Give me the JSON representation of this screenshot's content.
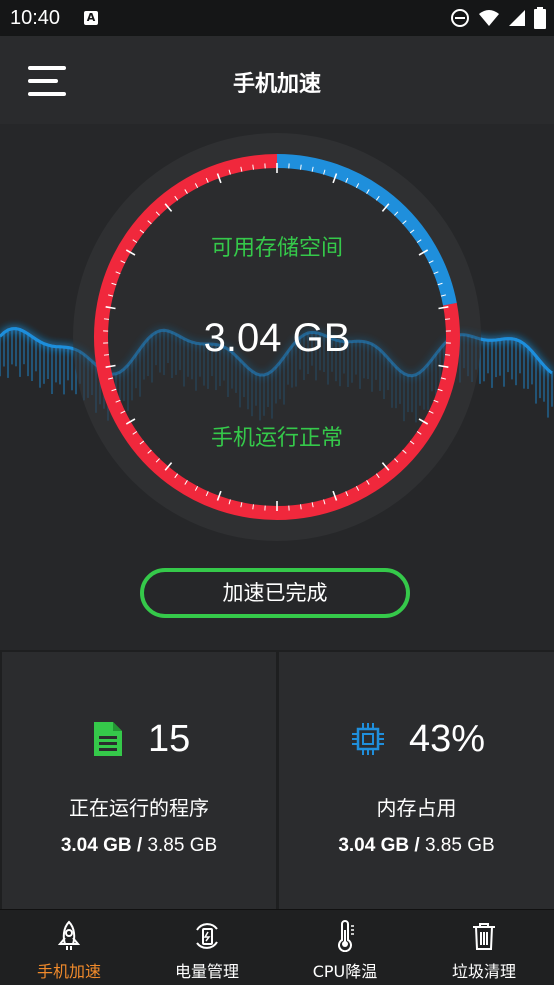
{
  "status_bar": {
    "time": "10:40",
    "notification_glyph": "A",
    "icons": [
      "dnd-icon",
      "wifi-icon",
      "signal-icon",
      "battery-icon"
    ]
  },
  "header": {
    "title": "手机加速",
    "menu_icon": "hamburger-menu-icon"
  },
  "gauge": {
    "top_label": "可用存储空间",
    "value": "3.04 GB",
    "bottom_label": "手机运行正常",
    "free_fraction": 0.22,
    "colors": {
      "used": "#f0283c",
      "free": "#1f8fdc",
      "wave": "#1f8fdc",
      "ring_bg": "#2f3032"
    }
  },
  "action_button": {
    "label": "加速已完成",
    "color": "#35c94a"
  },
  "stats": {
    "programs": {
      "icon": "document-icon",
      "count": "15",
      "label": "正在运行的程序",
      "used": "3.04 GB",
      "separator": " / ",
      "total": "3.85 GB"
    },
    "memory": {
      "icon": "cpu-chip-icon",
      "percent": "43%",
      "label": "内存占用",
      "used": "3.04 GB",
      "separator": " / ",
      "total": "3.85 GB"
    }
  },
  "tabs": [
    {
      "label": "手机加速",
      "icon": "rocket-icon",
      "active": true
    },
    {
      "label": "电量管理",
      "icon": "battery-refresh-icon",
      "active": false
    },
    {
      "label": "CPU降温",
      "icon": "thermometer-icon",
      "active": false
    },
    {
      "label": "垃圾清理",
      "icon": "trash-icon",
      "active": false
    }
  ],
  "accent": "#f08a2b"
}
